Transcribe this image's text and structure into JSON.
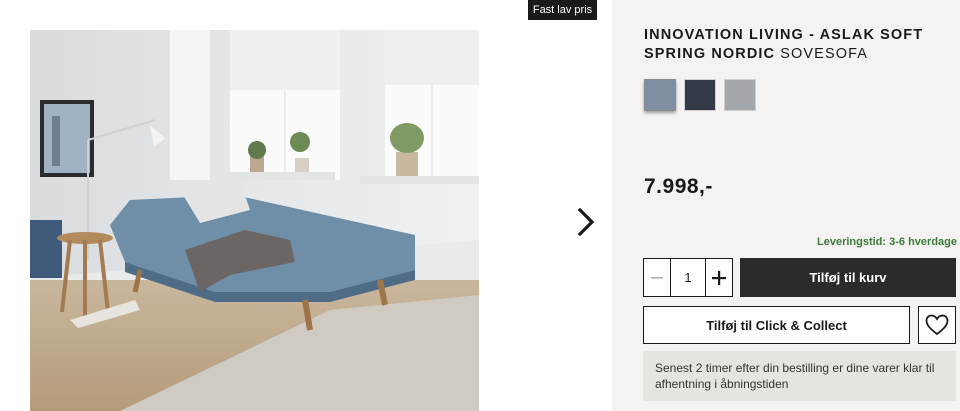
{
  "gallery": {
    "badge": "Fast lav pris",
    "image_alt": "Innovation Living Aslak sovesofa in living room",
    "next_icon": "chevron-right-icon"
  },
  "product": {
    "title_bold": "INNOVATION LIVING - ASLAK SOFT SPRING NORDIC",
    "title_light": "SOVESOFA",
    "swatches": [
      {
        "color": "#7f8fa3",
        "selected": true
      },
      {
        "color": "#343a48",
        "selected": false
      },
      {
        "color": "#a4a7ab",
        "selected": false
      }
    ],
    "price": "7.998,-",
    "delivery": "Leveringstid: 3-6 hverdage",
    "quantity": "1",
    "add_to_cart": "Tilføj til kurv",
    "click_collect": "Tilføj til Click & Collect",
    "wishlist_icon": "heart-icon",
    "notice": "Senest 2 timer efter din bestilling er dine varer klar til afhentning i åbningstiden"
  },
  "colors": {
    "dark": "#2b2b2b",
    "panel": "#f4f3f1",
    "notice_bg": "#e7e4e0",
    "delivery_green": "#3d7a3d"
  }
}
